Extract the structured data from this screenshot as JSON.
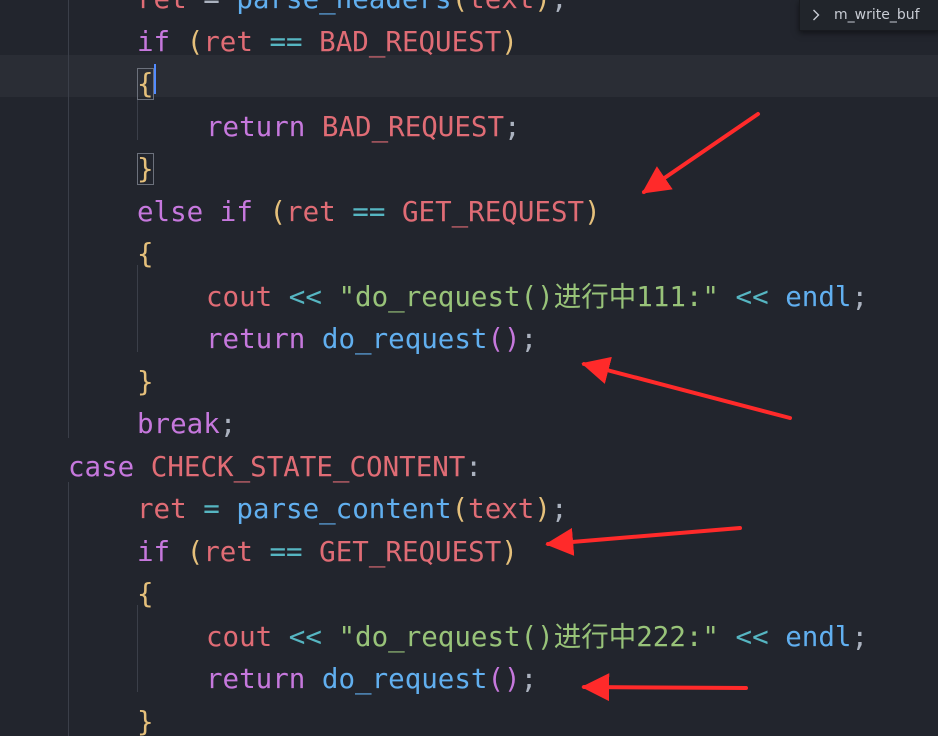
{
  "editor": {
    "lines": [
      [
        {
          "t": "ret",
          "c": "var"
        },
        {
          "t": " = ",
          "c": "pun"
        },
        {
          "t": "parse_headers",
          "c": "fn"
        },
        {
          "t": "(",
          "c": "p1"
        },
        {
          "t": "text",
          "c": "var"
        },
        {
          "t": ")",
          "c": "p1"
        },
        {
          "t": ";",
          "c": "pun"
        }
      ],
      [
        {
          "t": "if",
          "c": "kw"
        },
        {
          "t": " ",
          "c": "pun"
        },
        {
          "t": "(",
          "c": "p1"
        },
        {
          "t": "ret",
          "c": "var"
        },
        {
          "t": " == ",
          "c": "op"
        },
        {
          "t": "BAD_REQUEST",
          "c": "const"
        },
        {
          "t": ")",
          "c": "p1"
        }
      ],
      [
        {
          "t": "{",
          "c": "br",
          "match": true
        }
      ],
      [
        {
          "t": "return",
          "c": "kw"
        },
        {
          "t": " ",
          "c": "pun"
        },
        {
          "t": "BAD_REQUEST",
          "c": "const"
        },
        {
          "t": ";",
          "c": "pun"
        }
      ],
      [
        {
          "t": "}",
          "c": "br",
          "match": true
        }
      ],
      [
        {
          "t": "else",
          "c": "kw"
        },
        {
          "t": " ",
          "c": "pun"
        },
        {
          "t": "if",
          "c": "kw"
        },
        {
          "t": " ",
          "c": "pun"
        },
        {
          "t": "(",
          "c": "p1"
        },
        {
          "t": "ret",
          "c": "var"
        },
        {
          "t": " == ",
          "c": "op"
        },
        {
          "t": "GET_REQUEST",
          "c": "const"
        },
        {
          "t": ")",
          "c": "p1"
        }
      ],
      [
        {
          "t": "{",
          "c": "br"
        }
      ],
      [
        {
          "t": "cout",
          "c": "var"
        },
        {
          "t": " << ",
          "c": "op"
        },
        {
          "t": "\"do_request()进行中111:\"",
          "c": "str"
        },
        {
          "t": " << ",
          "c": "op"
        },
        {
          "t": "endl",
          "c": "fn"
        },
        {
          "t": ";",
          "c": "pun"
        }
      ],
      [
        {
          "t": "return",
          "c": "kw"
        },
        {
          "t": " ",
          "c": "pun"
        },
        {
          "t": "do_request",
          "c": "fn"
        },
        {
          "t": "()",
          "c": "p2"
        },
        {
          "t": ";",
          "c": "pun"
        }
      ],
      [
        {
          "t": "}",
          "c": "br"
        }
      ],
      [
        {
          "t": "break",
          "c": "kw"
        },
        {
          "t": ";",
          "c": "pun"
        }
      ],
      [
        {
          "t": "case",
          "c": "kw"
        },
        {
          "t": " ",
          "c": "pun"
        },
        {
          "t": "CHECK_STATE_CONTENT",
          "c": "const"
        },
        {
          "t": ":",
          "c": "pun"
        }
      ],
      [
        {
          "t": "ret",
          "c": "var"
        },
        {
          "t": " = ",
          "c": "op"
        },
        {
          "t": "parse_content",
          "c": "fn"
        },
        {
          "t": "(",
          "c": "p1"
        },
        {
          "t": "text",
          "c": "var"
        },
        {
          "t": ")",
          "c": "p1"
        },
        {
          "t": ";",
          "c": "pun"
        }
      ],
      [
        {
          "t": "if",
          "c": "kw"
        },
        {
          "t": " ",
          "c": "pun"
        },
        {
          "t": "(",
          "c": "p1"
        },
        {
          "t": "ret",
          "c": "var"
        },
        {
          "t": " == ",
          "c": "op"
        },
        {
          "t": "GET_REQUEST",
          "c": "const"
        },
        {
          "t": ")",
          "c": "p1"
        }
      ],
      [
        {
          "t": "{",
          "c": "br"
        }
      ],
      [
        {
          "t": "cout",
          "c": "var"
        },
        {
          "t": " << ",
          "c": "op"
        },
        {
          "t": "\"do_request()进行中222:\"",
          "c": "str"
        },
        {
          "t": " << ",
          "c": "op"
        },
        {
          "t": "endl",
          "c": "fn"
        },
        {
          "t": ";",
          "c": "pun"
        }
      ],
      [
        {
          "t": "return",
          "c": "kw"
        },
        {
          "t": " ",
          "c": "pun"
        },
        {
          "t": "do_request",
          "c": "fn"
        },
        {
          "t": "()",
          "c": "p2"
        },
        {
          "t": ";",
          "c": "pun"
        }
      ],
      [
        {
          "t": "}",
          "c": "br"
        }
      ]
    ],
    "colors": {
      "background": "#22252d",
      "keyword": "#c678dd",
      "variable": "#e06c75",
      "function": "#61afef",
      "string": "#98c379",
      "bracket": "#e5c07b",
      "annotation_arrow": "#ff2a2a"
    }
  },
  "breadcrumb": {
    "icon": "chevron-right-icon",
    "label": "m_write_buf"
  }
}
